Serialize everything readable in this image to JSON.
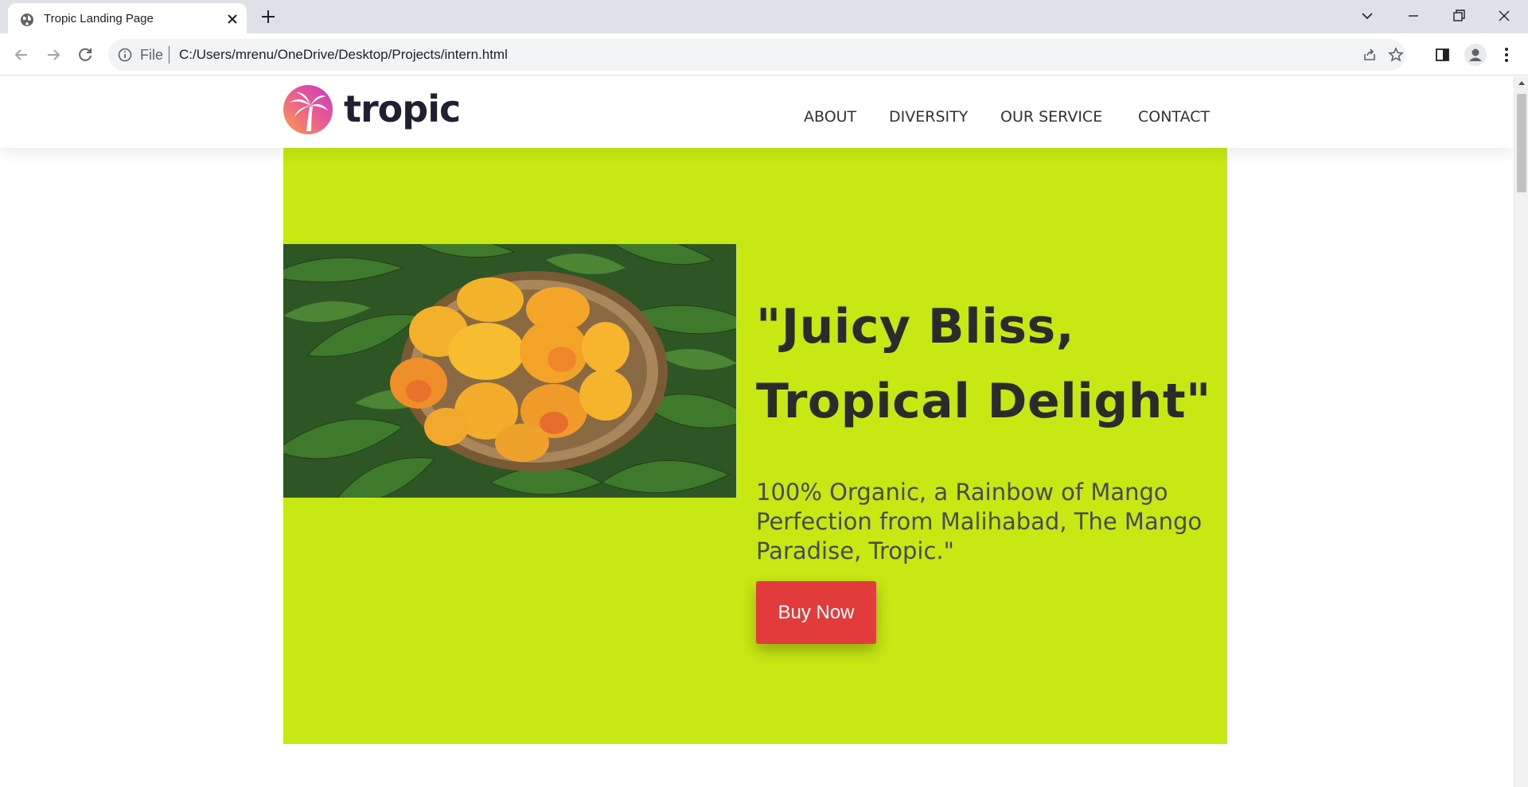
{
  "browser": {
    "tab": {
      "title": "Tropic Landing Page"
    },
    "address_bar": {
      "scheme_label": "File",
      "url": "C:/Users/mrenu/OneDrive/Desktop/Projects/intern.html"
    },
    "icons": {
      "favicon": "globe-icon",
      "close_tab": "close-icon",
      "new_tab": "plus-icon",
      "back": "arrow-left-icon",
      "forward": "arrow-right-icon",
      "reload": "reload-icon",
      "site_info": "info-icon",
      "share": "share-icon",
      "bookmark": "star-icon",
      "side_panel": "side-panel-icon",
      "profile": "profile-icon",
      "menu": "kebab-menu-icon",
      "tab_search": "chevron-down-icon",
      "minimize": "minimize-icon",
      "restore": "restore-icon",
      "close_window": "close-icon"
    }
  },
  "site": {
    "brand": "tropic",
    "nav": [
      "ABOUT",
      "DIVERSITY",
      "OUR SERVICE",
      "CONTACT"
    ],
    "hero": {
      "title_line1": "\"Juicy Bliss,",
      "title_line2": "Tropical Delight\"",
      "subtitle": "100% Organic, a Rainbow of Mango Perfection from Malihabad, The Mango Paradise, Tropic.\"",
      "cta_label": "Buy Now",
      "image_subject": "mango-basket-image"
    }
  },
  "colors": {
    "hero_background": "#c8e813",
    "cta_background": "#e23b3b",
    "logo_gradient_start": "#f7a24a",
    "logo_gradient_end": "#c837c8",
    "brand_text": "#1f2030"
  }
}
